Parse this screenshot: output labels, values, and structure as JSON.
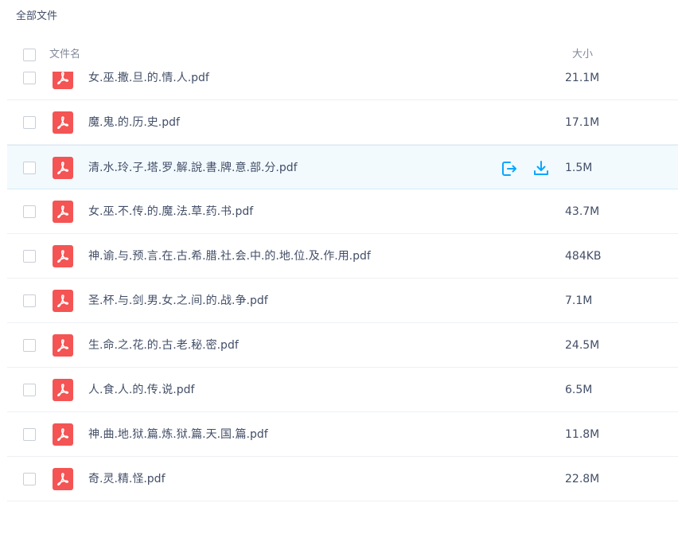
{
  "breadcrumb": "全部文件",
  "header": {
    "name_label": "文件名",
    "size_label": "大小"
  },
  "colors": {
    "accent": "#06a7ff",
    "pdf": "#f45454",
    "hover_bg": "#f2fafe"
  },
  "files": [
    {
      "name": "女.巫.撒.旦.的.情.人.pdf",
      "size": "21.1M",
      "icon": "pdf-icon"
    },
    {
      "name": "魔.鬼.的.历.史.pdf",
      "size": "17.1M",
      "icon": "pdf-icon"
    },
    {
      "name": "清.水.玲.子.塔.罗.解.說.書.牌.意.部.分.pdf",
      "size": "1.5M",
      "icon": "pdf-icon",
      "hovered": true
    },
    {
      "name": "女.巫.不.传.的.魔.法.草.药.书.pdf",
      "size": "43.7M",
      "icon": "pdf-icon"
    },
    {
      "name": "神.谕.与.预.言.在.古.希.腊.社.会.中.的.地.位.及.作.用.pdf",
      "size": "484KB",
      "icon": "pdf-icon"
    },
    {
      "name": "圣.杯.与.剑.男.女.之.间.的.战.争.pdf",
      "size": "7.1M",
      "icon": "pdf-icon"
    },
    {
      "name": "生.命.之.花.的.古.老.秘.密.pdf",
      "size": "24.5M",
      "icon": "pdf-icon"
    },
    {
      "name": "人.食.人.的.传.说.pdf",
      "size": "6.5M",
      "icon": "pdf-icon"
    },
    {
      "name": "神.曲.地.狱.篇.炼.狱.篇.天.国.篇.pdf",
      "size": "11.8M",
      "icon": "pdf-icon"
    },
    {
      "name": "奇.灵.精.怪.pdf",
      "size": "22.8M",
      "icon": "pdf-icon"
    }
  ],
  "row_actions": {
    "share_icon": "share-icon",
    "download_icon": "download-icon"
  }
}
